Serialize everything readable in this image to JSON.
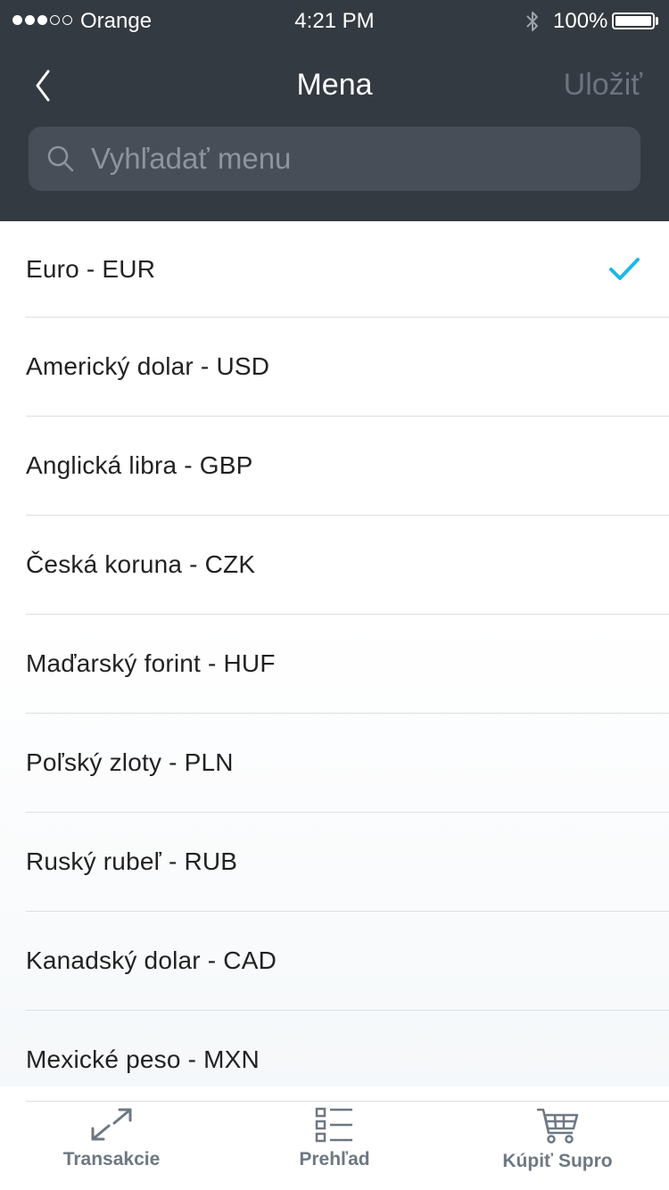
{
  "status_bar": {
    "carrier": "Orange",
    "time": "4:21 PM",
    "battery": "100%",
    "signal_bars_filled": 3,
    "signal_bars_total": 5
  },
  "nav": {
    "title": "Mena",
    "save_label": "Uložiť",
    "back_icon": "chevron-left-icon"
  },
  "search": {
    "placeholder": "Vyhľadať menu",
    "value": "",
    "icon": "search-icon"
  },
  "currencies": [
    {
      "label": "Euro - EUR",
      "selected": true
    },
    {
      "label": "Americký dolar - USD",
      "selected": false
    },
    {
      "label": "Anglická libra - GBP",
      "selected": false
    },
    {
      "label": "Česká koruna - CZK",
      "selected": false
    },
    {
      "label": "Maďarský forint - HUF",
      "selected": false
    },
    {
      "label": "Poľský zloty - PLN",
      "selected": false
    },
    {
      "label": "Ruský rubeľ - RUB",
      "selected": false
    },
    {
      "label": "Kanadský dolar - CAD",
      "selected": false
    },
    {
      "label": "Mexické peso - MXN",
      "selected": false
    }
  ],
  "tab_bar": {
    "tabs": [
      {
        "label": "Transakcie",
        "icon": "transactions-arrows-icon"
      },
      {
        "label": "Prehľad",
        "icon": "list-overview-icon"
      },
      {
        "label": "Kúpiť Supro",
        "icon": "shopping-cart-icon"
      }
    ]
  },
  "colors": {
    "header_bg": "#343a41",
    "search_bg": "#474e57",
    "accent_check": "#1cb8e8",
    "tab_icon": "#6d7882",
    "save_disabled": "#6b7480"
  }
}
